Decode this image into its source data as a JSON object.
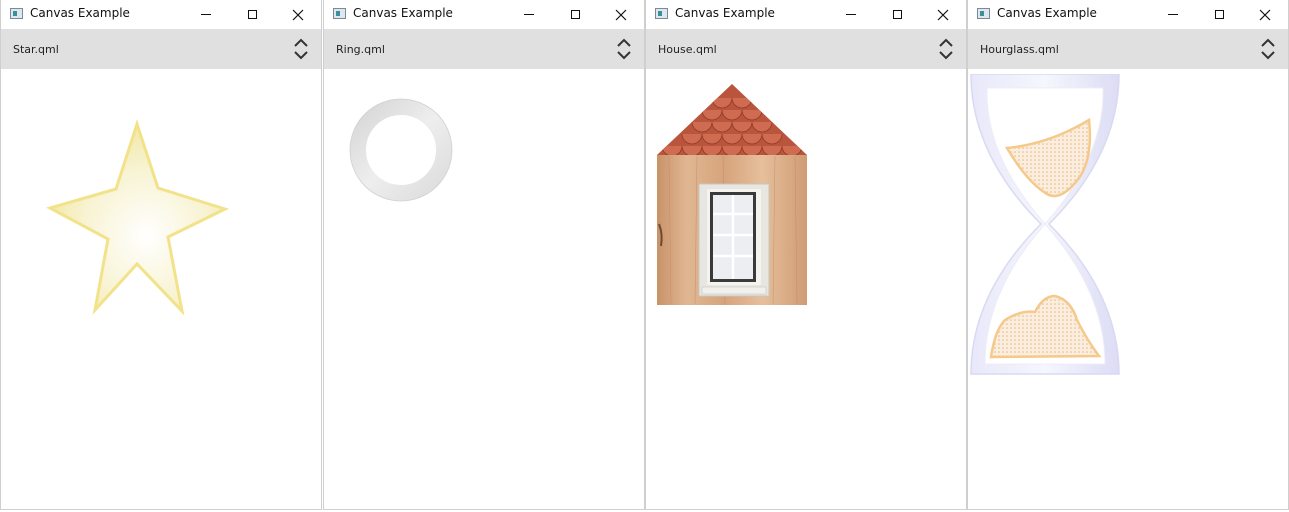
{
  "windows": [
    {
      "title": "Canvas Example",
      "selected_example": "Star.qml"
    },
    {
      "title": "Canvas Example",
      "selected_example": "Ring.qml"
    },
    {
      "title": "Canvas Example",
      "selected_example": "House.qml"
    },
    {
      "title": "Canvas Example",
      "selected_example": "Hourglass.qml"
    }
  ],
  "icons": {
    "app": "app-icon",
    "minimize": "minimize-icon",
    "maximize": "maximize-icon",
    "close": "close-icon",
    "combo": "chevron-up-down-icon"
  },
  "colors": {
    "combo_background": "#e0e0e0",
    "star_stroke": "#f2e28a",
    "star_fill": "#f7f1c6",
    "ring_stroke": "#dddddd",
    "roof_tile": "#c8644a",
    "wall_wood": "#d9a77e",
    "window_frame": "#ecebe6",
    "glass": "#eef0f3",
    "hourglass_glass": "#e4e4f8",
    "sand": "#f5c98a"
  }
}
